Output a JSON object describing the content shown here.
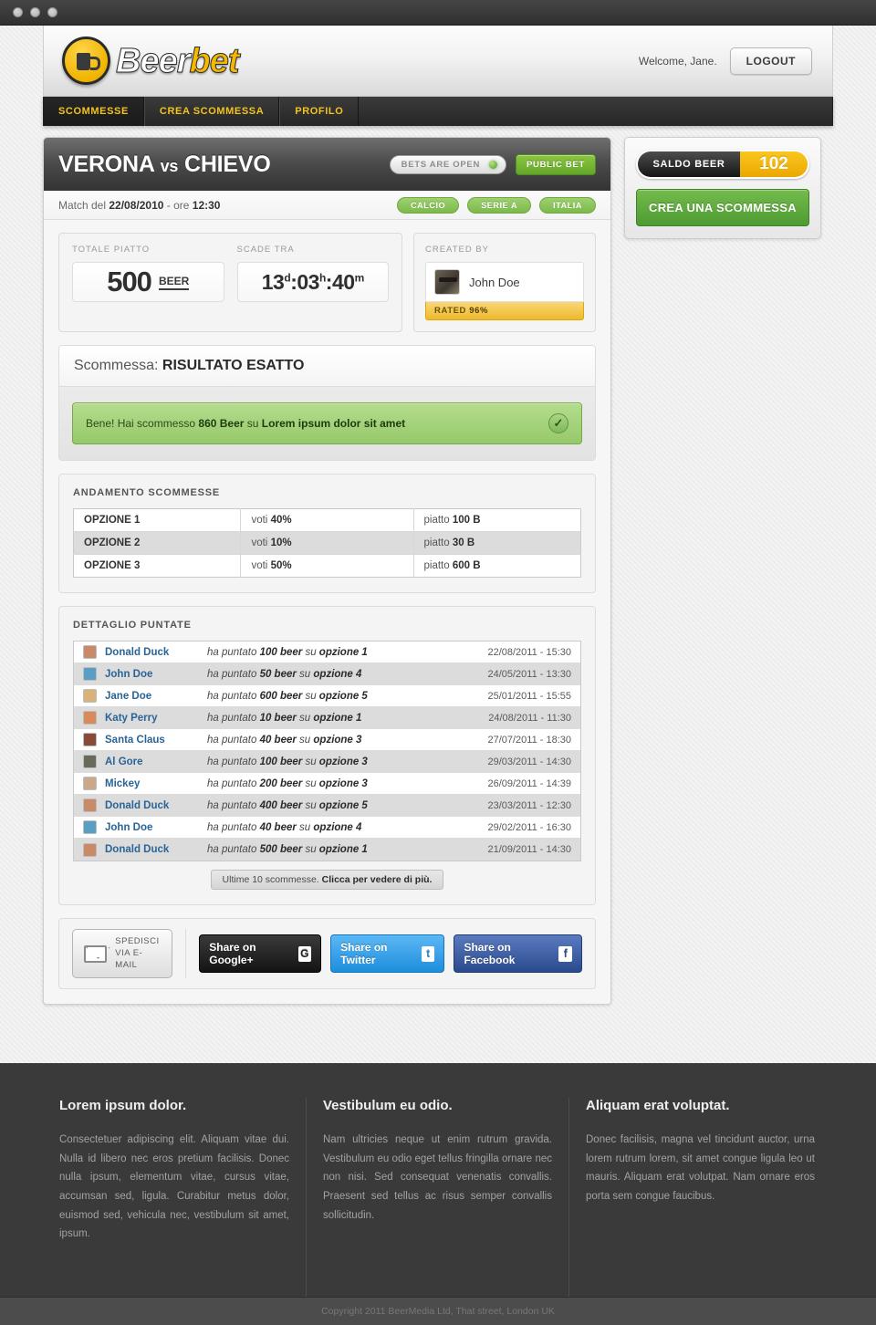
{
  "browser": {
    "dots": 3
  },
  "header": {
    "logo_part1": "Beer",
    "logo_part2": "bet",
    "welcome": "Welcome, Jane.",
    "logout_label": "LOGOUT"
  },
  "nav": {
    "items": [
      {
        "label": "SCOMMESSE",
        "active": true
      },
      {
        "label": "CREA SCOMMESSA",
        "active": false
      },
      {
        "label": "PROFILO",
        "active": false
      }
    ]
  },
  "match": {
    "team_home": "VERONA",
    "vs": "vs",
    "team_away": "CHIEVO",
    "status_label": "BETS ARE OPEN",
    "visibility_label": "PUBLIC BET",
    "subline_prefix": "Match del ",
    "date": "22/08/2010",
    "subline_mid": " - ore ",
    "time": "12:30",
    "tags": [
      "CALCIO",
      "SERIE A",
      "ITALIA"
    ]
  },
  "stats": {
    "pot_label": "TOTALE PIATTO",
    "pot_value": "500",
    "pot_unit": "BEER",
    "expires_label": "SCADE TRA",
    "countdown_days": "13",
    "countdown_days_unit": "d",
    "countdown_hours": "03",
    "countdown_hours_unit": "h",
    "countdown_mins": "40",
    "countdown_mins_unit": "m",
    "created_by_label": "CREATED BY",
    "creator_name": "John Doe",
    "rated_prefix": "RATED ",
    "rated_value": "96%"
  },
  "bet": {
    "panel_title_prefix": "Scommessa: ",
    "panel_title_value": "RISULTATO ESATTO",
    "success_prefix": "Bene! Hai scommesso ",
    "success_amount": "860 Beer",
    "success_mid": " su ",
    "success_target": "Lorem ipsum dolor sit amet",
    "check_glyph": "✓"
  },
  "trend": {
    "title": "ANDAMENTO SCOMMESSE",
    "rows": [
      {
        "option": "OPZIONE 1",
        "votes_label": "voti ",
        "votes": "40%",
        "pot_label": "piatto ",
        "pot": "100 B"
      },
      {
        "option": "OPZIONE 2",
        "votes_label": "voti ",
        "votes": "10%",
        "pot_label": "piatto ",
        "pot": "30 B"
      },
      {
        "option": "OPZIONE 3",
        "votes_label": "voti ",
        "votes": "50%",
        "pot_label": "piatto ",
        "pot": "600 B"
      }
    ]
  },
  "details": {
    "title": "DETTAGLIO PUNTATE",
    "more_prefix": "Ultime 10 scommesse. ",
    "more_bold": "Clicca per vedere di più.",
    "rows": [
      {
        "user": "Donald Duck",
        "pre": "ha puntato ",
        "amount": "100 beer",
        "mid": " su ",
        "option": "opzione 1",
        "date": "22/08/2011 - 15:30",
        "avatar": "#c98a6a"
      },
      {
        "user": "John Doe",
        "pre": "ha puntato ",
        "amount": "50 beer",
        "mid": " su ",
        "option": "opzione 4",
        "date": "24/05/2011 - 13:30",
        "avatar": "#5a9ec4"
      },
      {
        "user": "Jane Doe",
        "pre": "ha puntato ",
        "amount": "600 beer",
        "mid": " su ",
        "option": "opzione 5",
        "date": "25/01/2011 - 15:55",
        "avatar": "#d8b27a"
      },
      {
        "user": "Katy Perry",
        "pre": "ha puntato ",
        "amount": "10 beer",
        "mid": " su ",
        "option": "opzione 1",
        "date": "24/08/2011 - 11:30",
        "avatar": "#d88a5a"
      },
      {
        "user": "Santa Claus",
        "pre": "ha puntato ",
        "amount": "40 beer",
        "mid": " su ",
        "option": "opzione 3",
        "date": "27/07/2011 - 18:30",
        "avatar": "#8a4a3a"
      },
      {
        "user": "Al Gore",
        "pre": "ha puntato ",
        "amount": "100 beer",
        "mid": " su ",
        "option": "opzione 3",
        "date": "29/03/2011 - 14:30",
        "avatar": "#6a6a5a"
      },
      {
        "user": "Mickey",
        "pre": "ha puntato ",
        "amount": "200 beer",
        "mid": " su ",
        "option": "opzione 3",
        "date": "26/09/2011 - 14:39",
        "avatar": "#c9a98a"
      },
      {
        "user": "Donald Duck",
        "pre": "ha puntato ",
        "amount": "400 beer",
        "mid": " su ",
        "option": "opzione 5",
        "date": "23/03/2011 - 12:30",
        "avatar": "#c98a6a"
      },
      {
        "user": "John Doe",
        "pre": "ha puntato ",
        "amount": "40 beer",
        "mid": " su ",
        "option": "opzione 4",
        "date": "29/02/2011 - 16:30",
        "avatar": "#5a9ec4"
      },
      {
        "user": "Donald Duck",
        "pre": "ha puntato ",
        "amount": "500 beer",
        "mid": " su ",
        "option": "opzione 1",
        "date": "21/09/2011 - 14:30",
        "avatar": "#c98a6a"
      }
    ]
  },
  "share": {
    "email_line1": "SPEDISCI",
    "email_line2": "VIA E-MAIL",
    "google_label": "Share on Google+",
    "google_glyph": "G",
    "twitter_label": "Share on Twitter",
    "twitter_glyph": "t",
    "facebook_label": "Share on Facebook",
    "facebook_glyph": "f"
  },
  "sidebar": {
    "balance_label": "SALDO BEER",
    "balance_value": "102",
    "create_bet_label": "CREA UNA SCOMMESSA"
  },
  "footer": {
    "columns": [
      {
        "title": "Lorem ipsum dolor.",
        "body": "Consectetuer adipiscing elit. Aliquam vitae dui. Nulla id libero nec eros pretium facilisis. Donec nulla ipsum, elementum vitae, cursus vitae, accumsan sed, ligula. Curabitur metus dolor, euismod sed, vehicula nec, vestibulum sit amet, ipsum."
      },
      {
        "title": "Vestibulum eu odio.",
        "body": "Nam ultricies neque ut enim rutrum gravida. Vestibulum eu odio eget tellus fringilla ornare nec non nisi. Sed consequat venenatis convallis. Praesent sed tellus ac risus semper convallis sollicitudin."
      },
      {
        "title": "Aliquam erat voluptat.",
        "body": "Donec facilisis, magna vel tincidunt auctor, urna lorem rutrum lorem, sit amet congue ligula leo ut mauris. Aliquam erat volutpat. Nam ornare eros porta sem congue faucibus."
      }
    ],
    "copyright": "Copyright 2011 BeerMedia Ltd, That street, London UK"
  },
  "colors": {
    "accent_yellow": "#f5b800",
    "green": "#63a62b",
    "link_blue": "#2a6496"
  }
}
